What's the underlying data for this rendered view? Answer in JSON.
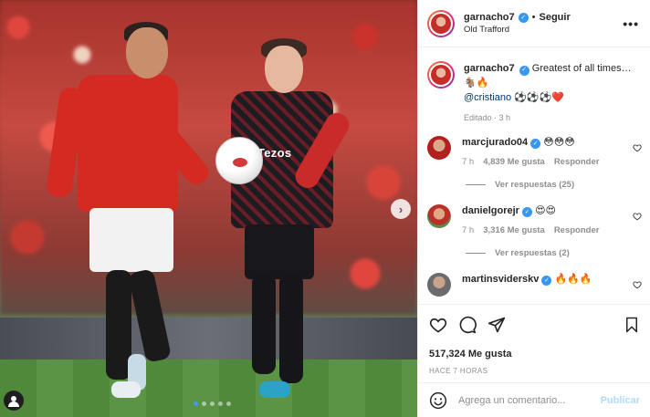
{
  "post": {
    "username": "garnacho7",
    "follow_separator": "•",
    "follow_label": "Seguir",
    "location": "Old Trafford",
    "more_label": "•••"
  },
  "caption": {
    "username": "garnacho7",
    "text": "Greatest of all times…🐐🔥",
    "mention": "@cristiano",
    "mention_suffix": "⚽⚽⚽❤️",
    "meta": "Editado · 3 h"
  },
  "comments": [
    {
      "username": "marcjurado04",
      "text": "😳😳😳",
      "time": "7 h",
      "likes": "4,839 Me gusta",
      "reply": "Responder",
      "view_replies": "Ver respuestas (25)"
    },
    {
      "username": "danielgorejr",
      "text": "😍😍",
      "time": "7 h",
      "likes": "3,316 Me gusta",
      "reply": "Responder",
      "view_replies": "Ver respuestas (2)"
    },
    {
      "username": "martinsviderskv",
      "text": "🔥🔥🔥"
    }
  ],
  "actions": {
    "likes": "517,324 Me gusta",
    "time": "HACE 7 HORAS"
  },
  "composer": {
    "placeholder": "Agrega un comentario...",
    "publish_label": "Publicar"
  },
  "photo": {
    "sponsor_text": "Tezos",
    "next_label": "›",
    "carousel_count": 5,
    "carousel_active": 1
  },
  "colors": {
    "accent": "#3897f0",
    "publish_disabled": "#b3dbff",
    "muted": "#8e8e8e"
  }
}
